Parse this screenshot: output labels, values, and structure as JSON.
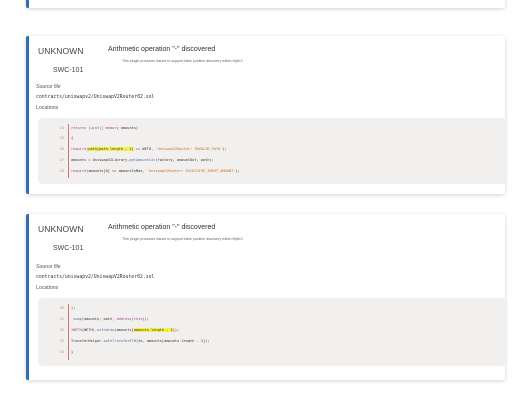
{
  "issues": [
    {
      "severity": "UNKNOWN",
      "swc_id": "SWC-101",
      "title": "Arithmetic operation \"-\" discovered",
      "description": "This plugin produces issues to support false positive discovery within MythX.",
      "source_file_label": "Source file",
      "source_file": "contracts/uniswapv2/UniswapV2Router02.sol",
      "locations_label": "Locations",
      "lines": [
        {
          "num": "24",
          "code": "returns (uint[] memory amounts)"
        },
        {
          "num": "25",
          "code": "{"
        },
        {
          "num": "26",
          "code": "require(path[path.length - 1] == WETH, 'UniswapV2Router: INVALID_PATH');"
        },
        {
          "num": "27",
          "code": "amounts = UniswapV2Library.getAmountsIn(factory, amountOut, path);"
        },
        {
          "num": "28",
          "code": "require(amounts[0] <= amountInMax, 'UniswapV2Router: EXCESSIVE_INPUT_AMOUNT');"
        }
      ]
    },
    {
      "severity": "UNKNOWN",
      "swc_id": "SWC-101",
      "title": "Arithmetic operation \"-\" discovered",
      "description": "This plugin produces issues to support false positive discovery within MythX.",
      "source_file_label": "Source file",
      "source_file": "contracts/uniswapv2/UniswapV2Router02.sol",
      "locations_label": "Locations",
      "lines": [
        {
          "num": "30",
          "code": ");"
        },
        {
          "num": "31",
          "code": "_swap(amounts, path, address(this));"
        },
        {
          "num": "32",
          "code": "IWETH(WETH).withdraw(amounts[amounts.length - 1]);"
        },
        {
          "num": "33",
          "code": "TransferHelper.safeTransferETH(to, amounts[amounts.length - 1]);"
        },
        {
          "num": "34",
          "code": "}"
        }
      ]
    }
  ],
  "colors": {
    "accent_border": "#2f6fad",
    "code_bg": "#f2f0ee",
    "highlight": "#f6f04a"
  }
}
